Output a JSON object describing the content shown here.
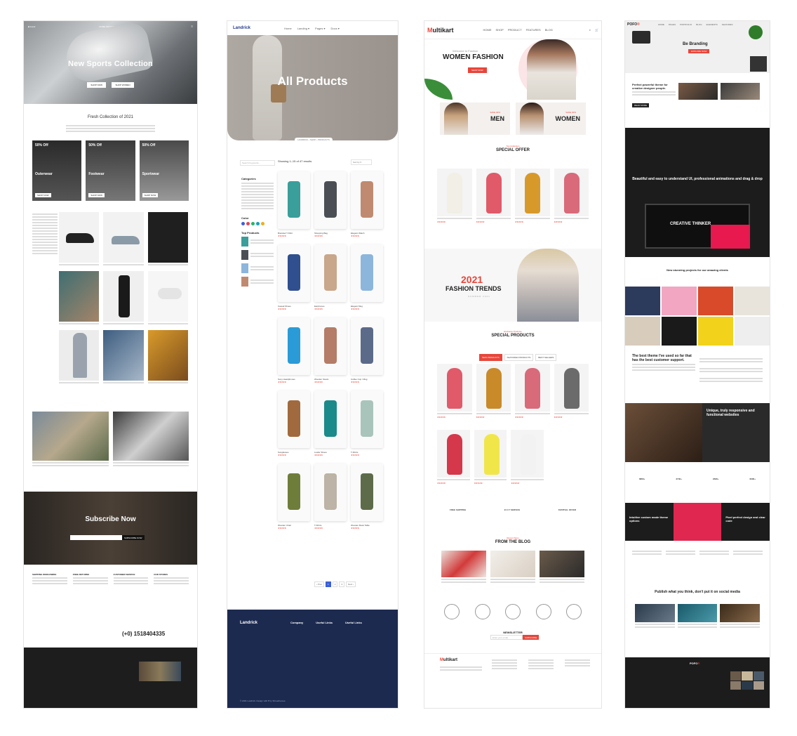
{
  "panel1": {
    "hero_title": "New Sports Collection",
    "hero_buttons": [
      "SHOP NOW",
      "SHOP WOMEN"
    ],
    "section_title": "Fresh Collection of 2021",
    "promo_cards": [
      {
        "discount": "50% Off",
        "name": "Outerwear",
        "button": "SHOP NOW"
      },
      {
        "discount": "50% Off",
        "name": "Footwear",
        "button": "SHOP NOW"
      },
      {
        "discount": "50% Off",
        "name": "Sportwear",
        "button": "SHOP NOW"
      }
    ],
    "subscribe_title": "Subscribe Now",
    "subscribe_button": "SUBSCRIBE NOW",
    "info_titles": [
      "SHIPPING WORLDWIDE",
      "FREE RETURNS",
      "CUSTOMER SERVICE",
      "OUR STORES"
    ],
    "phone": "(+0) 1518404335"
  },
  "panel2": {
    "logo": "Landrick",
    "hero_title": "All Products",
    "search_placeholder": "Search Keywords...",
    "showing": "Showing 1–15 of 47 results",
    "sidebar_titles": [
      "Categories",
      "Color",
      "Top Products"
    ],
    "colors": [
      "#3a5fd9",
      "#e0485b",
      "#28b463",
      "#17a2b8",
      "#f0ad1f"
    ],
    "products": [
      {
        "name": "Branded T-Shirt",
        "color": "#3a9e9a"
      },
      {
        "name": "Shopping Bag",
        "color": "#4b4f55"
      },
      {
        "name": "Elegant Watch",
        "color": "#c08a70"
      },
      {
        "name": "Casual Shoes",
        "color": "#2f4f8f"
      },
      {
        "name": "Earphones",
        "color": "#c9a78a"
      },
      {
        "name": "Elegant Mug",
        "color": "#8cb6dc"
      },
      {
        "name": "Sony Headphones",
        "color": "#2a9bd7"
      },
      {
        "name": "Wooden Stools",
        "color": "#b57c67"
      },
      {
        "name": "Coffee Cup / Mug",
        "color": "#5c6a8a"
      },
      {
        "name": "Sunglasses",
        "color": "#a06a3e"
      },
      {
        "name": "Loafer Shoes",
        "color": "#1b8a8a"
      },
      {
        "name": "T-Shirts",
        "color": "#a9c4bb"
      },
      {
        "name": "Wooden Chair",
        "color": "#6f7d3a"
      },
      {
        "name": "T-Shirts",
        "color": "#bdb3a6"
      },
      {
        "name": "Wooden Book Table",
        "color": "#5d6b4a"
      }
    ],
    "footer_columns": [
      "Company",
      "Useful Links",
      "Useful Links"
    ],
    "copyright": "© 2021 Landrick. Design with ♥ by Shreethemes."
  },
  "panel3": {
    "logo_first": "M",
    "logo_rest": "ultikart",
    "hero_welcome": "Welcome to Fashion",
    "hero_title": "WOMEN FASHION",
    "hero_button": "SHOP NOW",
    "cat_men": "MEN",
    "cat_women": "WOMEN",
    "cat_save": "SAVE 30%",
    "special_offer": "SPECIAL OFFER",
    "special_sub": "Top Collection",
    "offer_colors": [
      "#f1efe6",
      "#e05a6a",
      "#d79a2a",
      "#d96a7a"
    ],
    "banner_year": "2021",
    "banner_title": "FASHION TRENDS",
    "banner_sub": "SUMMER 2021",
    "special_products": "SPECIAL PRODUCTS",
    "special_products_sub": "Exclusive Products",
    "tabs": [
      "NEW PRODUCTS",
      "FEATURED PRODUCTS",
      "BEST SELLERS"
    ],
    "sp_colors": [
      "#e05a6a",
      "#c98a2a",
      "#d96a7a",
      "#6b6b6b",
      "#d4384a",
      "#f0e64a",
      "#f2f2f2"
    ],
    "features": [
      "FREE SHIPPING",
      "24 X 7 SERVICE",
      "FESTIVAL OFFER"
    ],
    "blog_sub": "Recent Story",
    "blog_title": "FROM THE BLOG",
    "newsletter": "NEWSLETTER",
    "news_placeholder": "Enter your email",
    "news_button": "SUBSCRIBE"
  },
  "panel4": {
    "logo_first": "POFO",
    "logo_rest": "®",
    "hero_title": "Be Branding",
    "hero_button": "EXPLORE NOW",
    "intro_title": "Perfect powerful theme for creative designer people.",
    "dark_heading": "Beautiful and easy to understand UI, professional animations and drag & drop",
    "creative_title": "CREATIVE THINKER",
    "projects_title": "New stunning projects for our amazing clients",
    "feature_title": "The best theme I've used so far that has the best customer support.",
    "responsive_title": "Unique, truly responsive and functional websites",
    "stats": [
      "6850+",
      "2740+",
      "9530+",
      "6000+"
    ],
    "dark3": [
      "Intuitive custom made theme options",
      "",
      "Pixel perfect design and clear code"
    ],
    "publish_title": "Publish what you think, don't put it on social media"
  }
}
